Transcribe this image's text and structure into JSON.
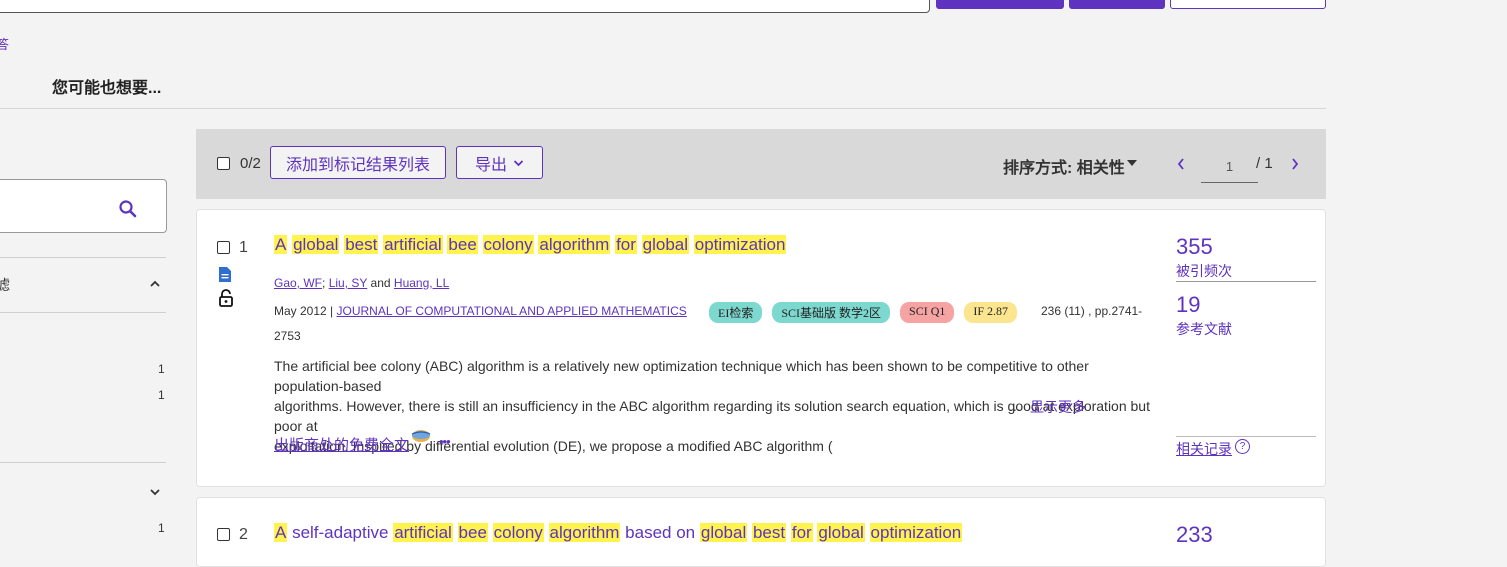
{
  "sidebar": {
    "left_link": "答",
    "filter_label": "滤",
    "counts": [
      "1",
      "1",
      "1"
    ]
  },
  "maybe_title": "您可能也想要...",
  "toolbar": {
    "selected": "0/2",
    "add_to_list": "添加到标记结果列表",
    "export": "导出",
    "sort": "排序方式: 相关性",
    "page_value": "1",
    "page_total": "/ 1"
  },
  "records": [
    {
      "num": "1",
      "title_parts": [
        {
          "t": "A",
          "h": true
        },
        {
          "t": " ",
          "h": false
        },
        {
          "t": "global",
          "h": true
        },
        {
          "t": " ",
          "h": false
        },
        {
          "t": "best",
          "h": true
        },
        {
          "t": " ",
          "h": false
        },
        {
          "t": "artificial",
          "h": true
        },
        {
          "t": " ",
          "h": false
        },
        {
          "t": "bee",
          "h": true
        },
        {
          "t": " ",
          "h": false
        },
        {
          "t": "colony",
          "h": true
        },
        {
          "t": " ",
          "h": false
        },
        {
          "t": "algorithm",
          "h": true
        },
        {
          "t": " ",
          "h": false
        },
        {
          "t": "for",
          "h": true
        },
        {
          "t": " ",
          "h": false
        },
        {
          "t": "global",
          "h": true
        },
        {
          "t": " ",
          "h": false
        },
        {
          "t": "optimization",
          "h": true
        }
      ],
      "authors": [
        "Gao, WF",
        "Liu, SY",
        "Huang, LL"
      ],
      "author_sep1": ";",
      "author_and": "and",
      "date": "May 2012 |",
      "journal": "JOURNAL OF COMPUTATIONAL AND APPLIED MATHEMATICS",
      "badges": [
        {
          "label": "EI检索",
          "color": "#7dd8cf"
        },
        {
          "label": "SCI基础版 数学2区",
          "color": "#7dd8cf"
        },
        {
          "label": "SCI Q1",
          "color": "#f5a3a3"
        },
        {
          "label": "IF 2.87",
          "color": "#fce58f"
        }
      ],
      "volume": "236 (11) , pp.2741-",
      "pages_cont": "2753",
      "abstract": [
        "The artificial bee colony (ABC) algorithm is a relatively new optimization technique which has been shown to be competitive to other population-based",
        "algorithms. However, there is still an insufficiency in the ABC algorithm regarding its solution search equation, which is good at exploration but poor at",
        "exploitation. Inspired by differential evolution (DE), we propose a modified ABC algorithm ("
      ],
      "ellipsis": "...",
      "show_more": "显示更多",
      "free_full_text": "出版商处的免费全文",
      "more": "•••",
      "citations": "355",
      "citations_label": "被引频次",
      "references": "19",
      "references_label": "参考文献",
      "related": "相关记录",
      "help": "?"
    },
    {
      "num": "2",
      "title_parts": [
        {
          "t": "A",
          "h": true
        },
        {
          "t": " self-adaptive ",
          "h": false
        },
        {
          "t": "artificial",
          "h": true
        },
        {
          "t": " ",
          "h": false
        },
        {
          "t": "bee",
          "h": true
        },
        {
          "t": " ",
          "h": false
        },
        {
          "t": "colony",
          "h": true
        },
        {
          "t": " ",
          "h": false
        },
        {
          "t": "algorithm",
          "h": true
        },
        {
          "t": " based on ",
          "h": false
        },
        {
          "t": "global",
          "h": true
        },
        {
          "t": " ",
          "h": false
        },
        {
          "t": "best",
          "h": true
        },
        {
          "t": " ",
          "h": false
        },
        {
          "t": "for",
          "h": true
        },
        {
          "t": " ",
          "h": false
        },
        {
          "t": "global",
          "h": true
        },
        {
          "t": " ",
          "h": false
        },
        {
          "t": "optimization",
          "h": true
        }
      ],
      "citations": "233"
    }
  ],
  "colors": {
    "accent": "#5e33bf",
    "highlight": "#fff34d"
  }
}
